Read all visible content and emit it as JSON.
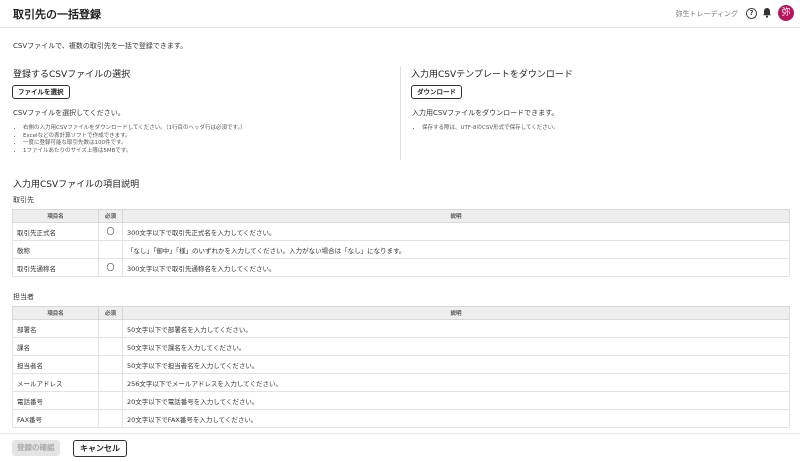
{
  "header": {
    "title": "取引先の一括登録",
    "company": "弥生トレーディング",
    "help_icon": "help-circle-icon",
    "bell_icon": "bell-icon",
    "avatar_text": "弥",
    "avatar_color": "#b3175a"
  },
  "intro": "CSVファイルで、複数の取引先を一括で登録できます。",
  "upload": {
    "heading": "登録するCSVファイルの選択",
    "button": "ファイルを選択",
    "desc": "CSVファイルを選択してください。",
    "notes": [
      "右側の入力用CSVファイルをダウンロードしてください。（1行目のヘッダ行は必須です。）",
      "Excelなどの表計算ソフトで作成できます。",
      "一度に登録可能な取引先数は100件です。",
      "1ファイルあたりのサイズ上限は5MBです。"
    ]
  },
  "download": {
    "heading": "入力用CSVテンプレートをダウンロード",
    "button": "ダウンロード",
    "desc": "入力用CSVファイルをダウンロードできます。",
    "notes": [
      "保存する際は、UTF-8のCSV形式で保存してください。"
    ]
  },
  "spec": {
    "heading": "入力用CSVファイルの項目説明",
    "columns": {
      "item": "項目名",
      "required": "必須",
      "description": "説明"
    },
    "required_mark": "〇",
    "partner": {
      "label": "取引先",
      "rows": [
        {
          "item": "取引先正式名",
          "required": "〇",
          "description": "300文字以下で取引先正式名を入力してください。"
        },
        {
          "item": "敬称",
          "required": "",
          "description": "「なし」「御中」「様」のいずれかを入力してください。入力がない場合は「なし」になります。"
        },
        {
          "item": "取引先通称名",
          "required": "〇",
          "description": "300文字以下で取引先通称名を入力してください。"
        }
      ]
    },
    "contact": {
      "label": "担当者",
      "rows": [
        {
          "item": "部署名",
          "required": "",
          "description": "50文字以下で部署名を入力してください。"
        },
        {
          "item": "課名",
          "required": "",
          "description": "50文字以下で課名を入力してください。"
        },
        {
          "item": "担当者名",
          "required": "",
          "description": "50文字以下で担当者名を入力してください。"
        },
        {
          "item": "メールアドレス",
          "required": "",
          "description": "256文字以下でメールアドレスを入力してください。"
        },
        {
          "item": "電話番号",
          "required": "",
          "description": "20文字以下で電話番号を入力してください。"
        },
        {
          "item": "FAX番号",
          "required": "",
          "description": "20文字以下でFAX番号を入力してください。"
        }
      ]
    }
  },
  "footer": {
    "confirm": "登録の確認",
    "cancel": "キャンセル"
  }
}
